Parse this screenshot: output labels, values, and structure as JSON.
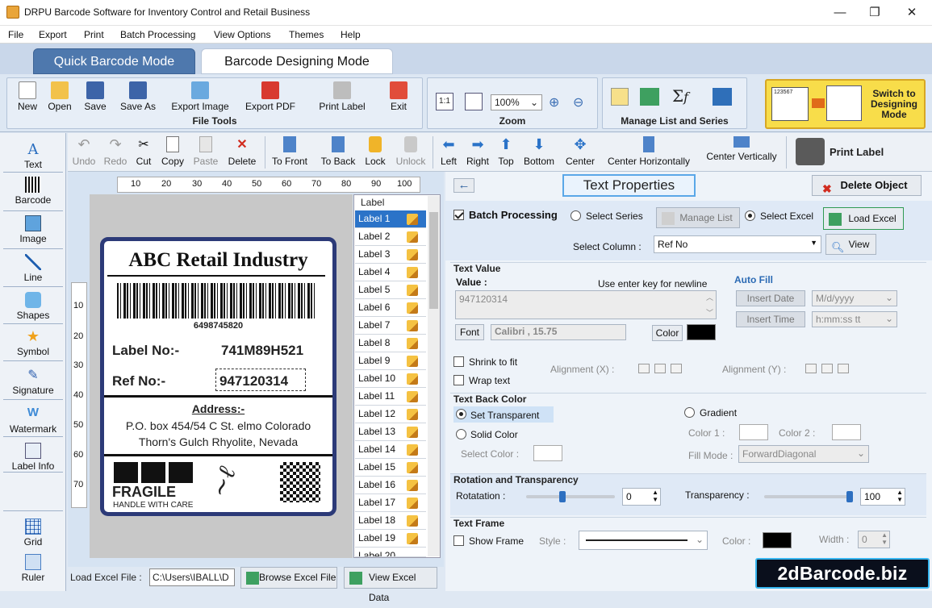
{
  "window": {
    "title": "DRPU Barcode Software for Inventory Control and Retail Business",
    "minimize": "—",
    "maximize": "❐",
    "close": "✕"
  },
  "menu": [
    "File",
    "Export",
    "Print",
    "Batch Processing",
    "View Options",
    "Themes",
    "Help"
  ],
  "modes": {
    "quick": "Quick Barcode Mode",
    "designing": "Barcode Designing Mode"
  },
  "file_tools": {
    "label": "File Tools",
    "buttons": [
      "New",
      "Open",
      "Save",
      "Save As",
      "Export Image",
      "Export PDF",
      "Print Label",
      "Exit"
    ]
  },
  "zoom": {
    "label": "Zoom",
    "value": "100%"
  },
  "manage": {
    "label": "Manage List and Series"
  },
  "switch_mode": {
    "label": "Switch to Designing Mode",
    "barcode_text": "123567"
  },
  "edit_tools": [
    "Undo",
    "Redo",
    "Cut",
    "Copy",
    "Paste",
    "Delete",
    "To Front",
    "To Back",
    "Lock",
    "Unlock",
    "Left",
    "Right",
    "Top",
    "Bottom",
    "Center",
    "Center Horizontally",
    "Center Vertically"
  ],
  "print_label": "Print Label",
  "left_tools": [
    "Text",
    "Barcode",
    "Image",
    "Line",
    "Shapes",
    "Symbol",
    "Signature",
    "Watermark",
    "Label Info",
    "Grid",
    "Ruler"
  ],
  "ruler": {
    "h": [
      "10",
      "20",
      "30",
      "40",
      "50",
      "60",
      "70",
      "80",
      "90",
      "100"
    ],
    "v": [
      "10",
      "20",
      "30",
      "40",
      "50",
      "60",
      "70"
    ]
  },
  "label": {
    "company": "ABC Retail Industry",
    "barcode_number": "6498745820",
    "label_no_caption": "Label No:-",
    "label_no_value": "741M89H521",
    "ref_no_caption": "Ref No:-",
    "ref_no_value": "947120314",
    "address_title": "Address:-",
    "address_line1": "P.O. box 454/54 C St. elmo Colorado",
    "address_line2": "Thorn's Gulch Rhyolite, Nevada",
    "fragile": "FRAGILE",
    "handle": "HANDLE WITH CARE"
  },
  "label_list": {
    "header": "Label",
    "items": [
      "Label 1",
      "Label 2",
      "Label 3",
      "Label 4",
      "Label 5",
      "Label 6",
      "Label 7",
      "Label 8",
      "Label 9",
      "Label 10",
      "Label 11",
      "Label 12",
      "Label 13",
      "Label 14",
      "Label 15",
      "Label 16",
      "Label 17",
      "Label 18",
      "Label 19",
      "Label 20"
    ]
  },
  "bottom": {
    "load_label": "Load Excel File :",
    "path": "C:\\Users\\IBALL\\D",
    "browse": "Browse Excel File",
    "view": "View Excel Data"
  },
  "props": {
    "back_icon": "←",
    "title": "Text Properties",
    "delete_object": "Delete Object",
    "batch": {
      "label": "Batch Processing",
      "select_series": "Select Series",
      "manage_list": "Manage List",
      "select_excel": "Select Excel",
      "load_excel": "Load Excel",
      "select_column_label": "Select Column :",
      "select_column_value": "Ref No",
      "view": "View"
    },
    "text_value": {
      "head": "Text Value",
      "value_label": "Value :",
      "hint": "Use enter key for newline",
      "value": "947120314",
      "font_btn": "Font",
      "font_value": "Calibri , 15.75",
      "color_btn": "Color",
      "color": "#000000"
    },
    "auto_fill": {
      "head": "Auto Fill",
      "insert_date": "Insert Date",
      "date_format": "M/d/yyyy",
      "insert_time": "Insert Time",
      "time_format": "h:mm:ss tt"
    },
    "shrink": "Shrink to fit",
    "wrap": "Wrap text",
    "align_x": "Alignment (X) :",
    "align_y": "Alignment (Y) :",
    "back_color": {
      "head": "Text Back Color",
      "transparent": "Set Transparent",
      "solid": "Solid Color",
      "select_color": "Select Color :",
      "gradient": "Gradient",
      "color1": "Color 1 :",
      "color2": "Color 2 :",
      "fill_mode_label": "Fill Mode :",
      "fill_mode": "ForwardDiagonal"
    },
    "rotation": {
      "head": "Rotation and Transparency",
      "rot_label": "Rotatation :",
      "rot_value": "0",
      "rot_fraction": 0.4,
      "trans_label": "Transparency :",
      "trans_value": "100",
      "trans_fraction": 1.0
    },
    "frame": {
      "head": "Text Frame",
      "show": "Show Frame",
      "style": "Style :",
      "color": "Color :",
      "width": "Width :",
      "width_value": "0",
      "frame_color": "#000000"
    }
  },
  "watermark": "2dBarcode.biz",
  "colors": {
    "accent": "#2b73c8",
    "mode_active": "#4e78ad",
    "label_border": "#2c3a78"
  }
}
